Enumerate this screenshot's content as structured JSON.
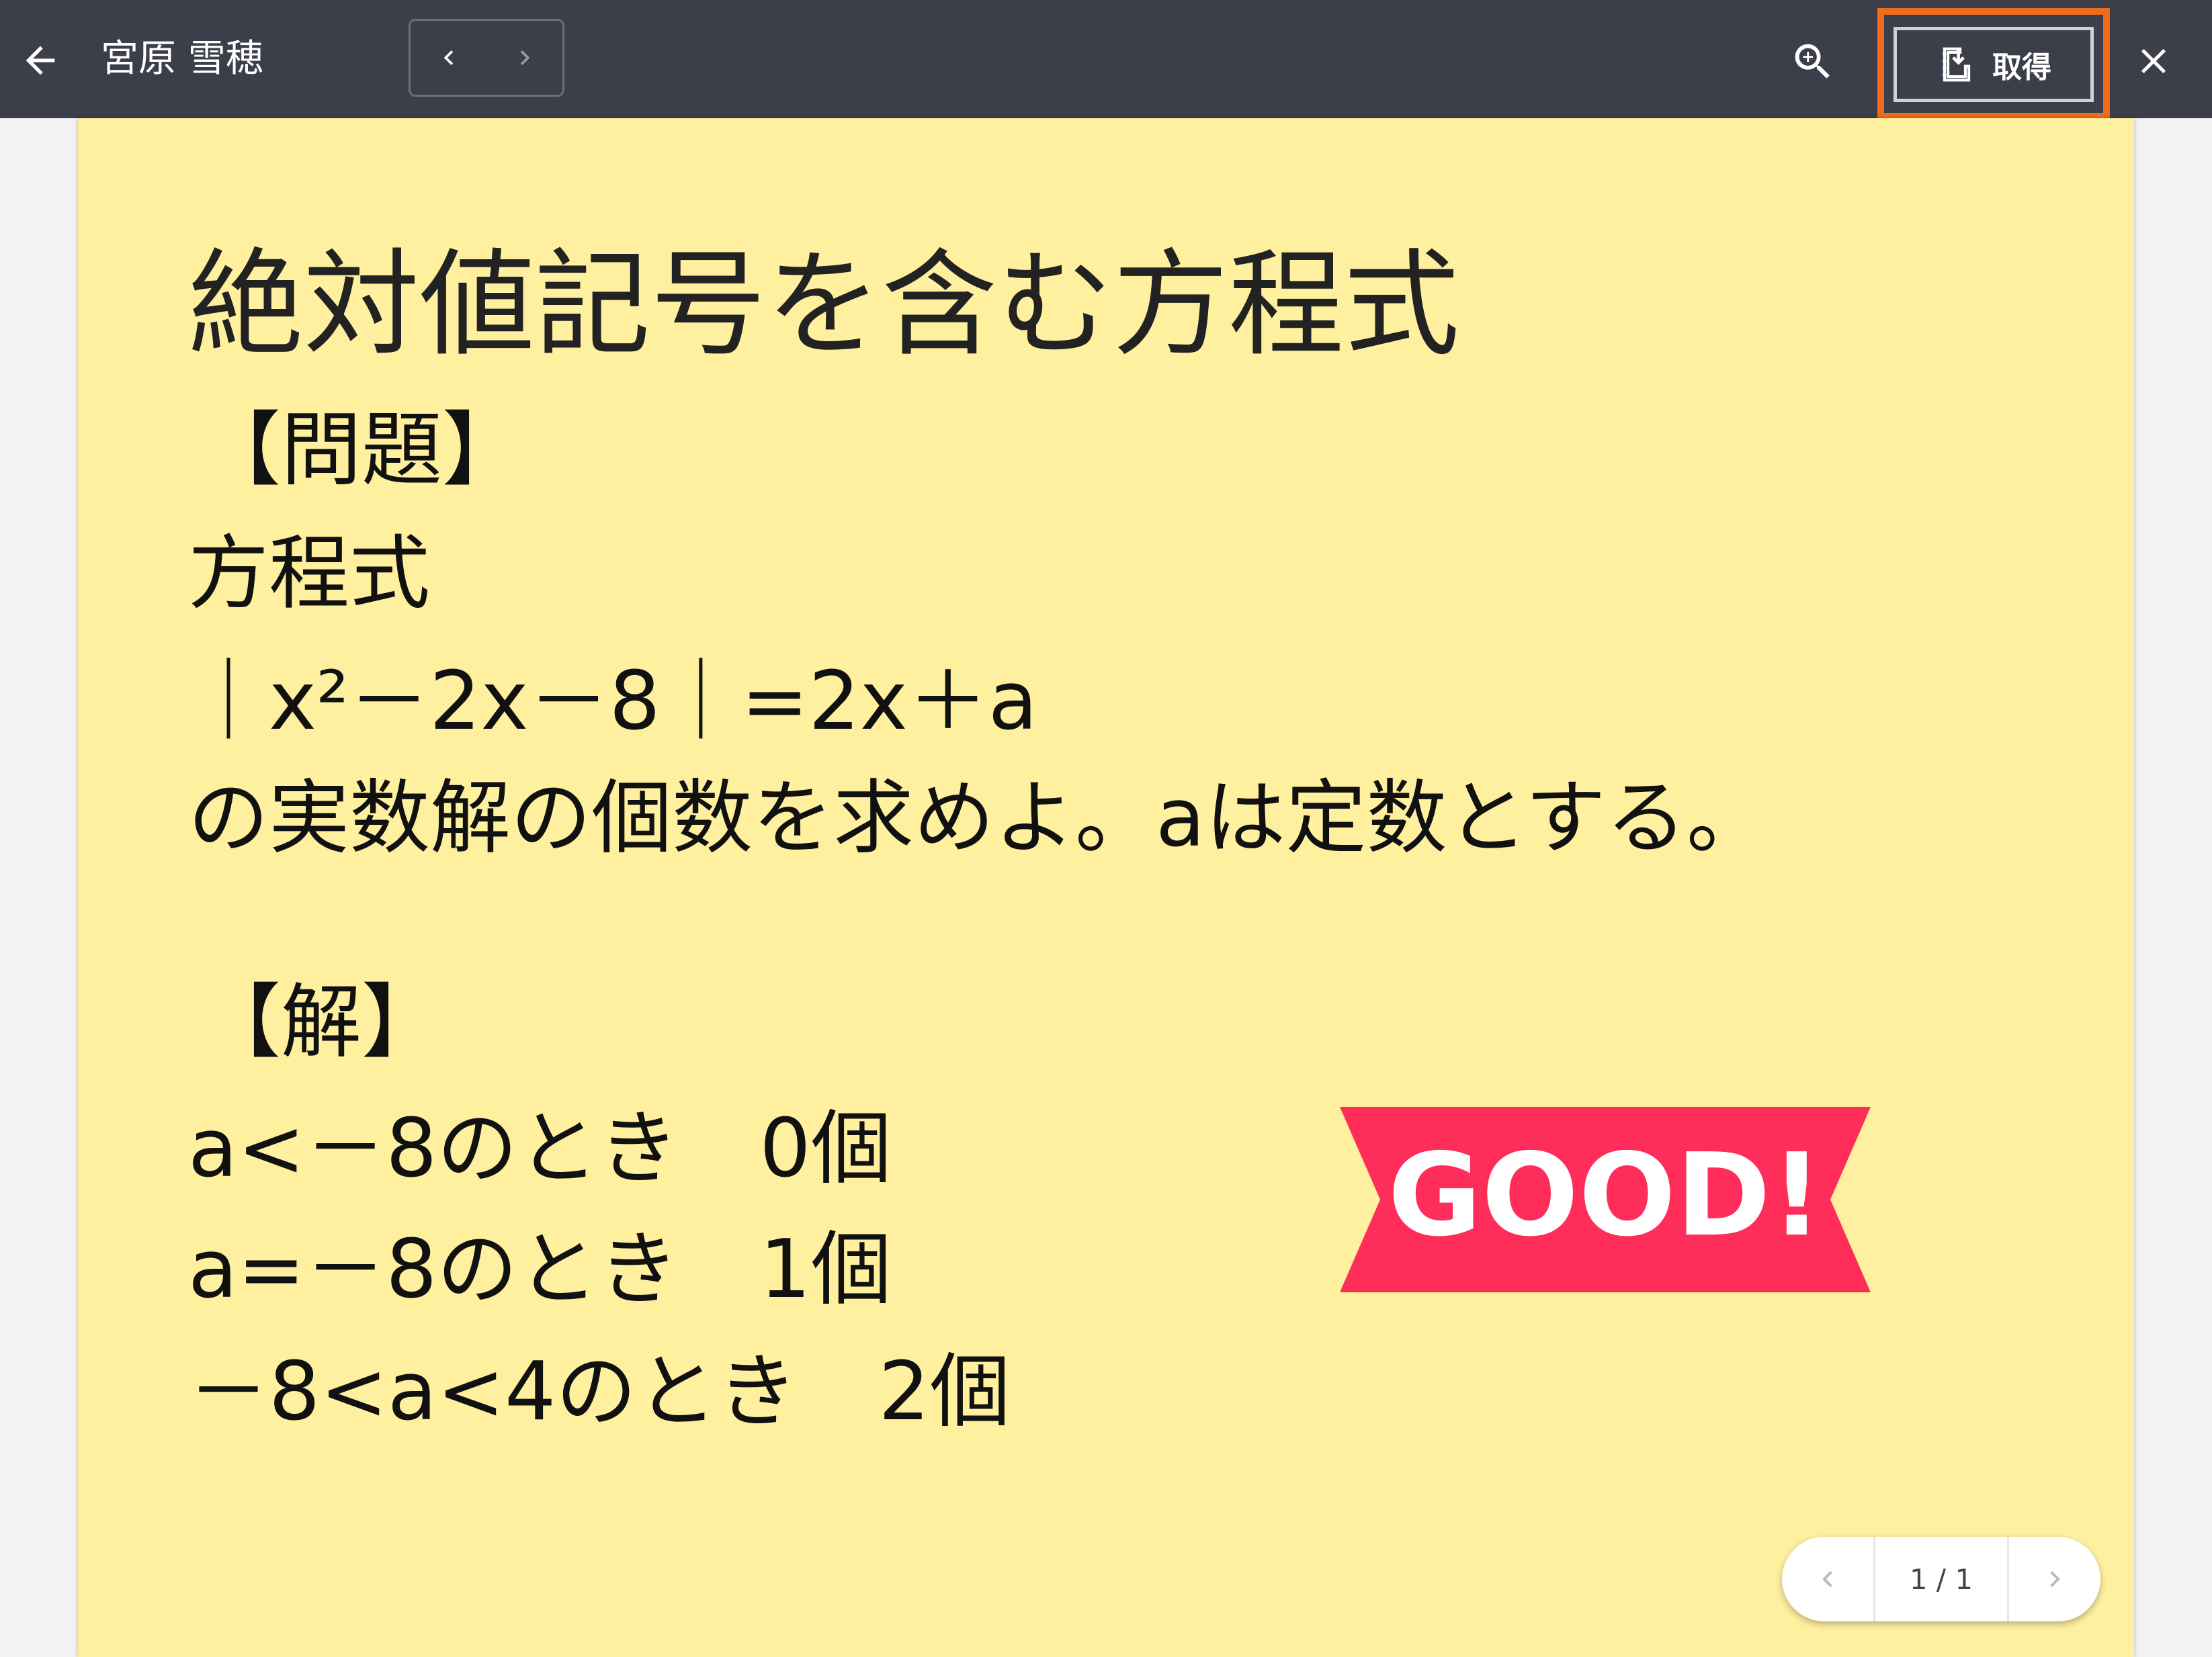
{
  "toolbar": {
    "user_name": "宮原 雪穂",
    "acquire_label": "取得",
    "icons": {
      "back": "arrow-left-icon",
      "prev": "chevron-left-icon",
      "next": "chevron-right-icon",
      "zoom": "zoom-in-icon",
      "acquire": "download-note-icon",
      "close": "close-icon"
    },
    "highlight_color": "#ec6d1c"
  },
  "note": {
    "background_color": "#fff09f",
    "title": "絶対値記号を含む方程式",
    "lines": [
      "【問題】",
      "方程式",
      "｜x²－2x－8｜=2x＋a",
      "の実数解の個数を求めよ。aは定数とする。",
      "【解】",
      "a<－8のとき　0個",
      "a=－8のとき　1個",
      "－8<a<4のとき　2個"
    ],
    "stamp": {
      "text": "GOOD!",
      "color": "#ff2d5a"
    }
  },
  "pager": {
    "text": "1 / 1"
  }
}
